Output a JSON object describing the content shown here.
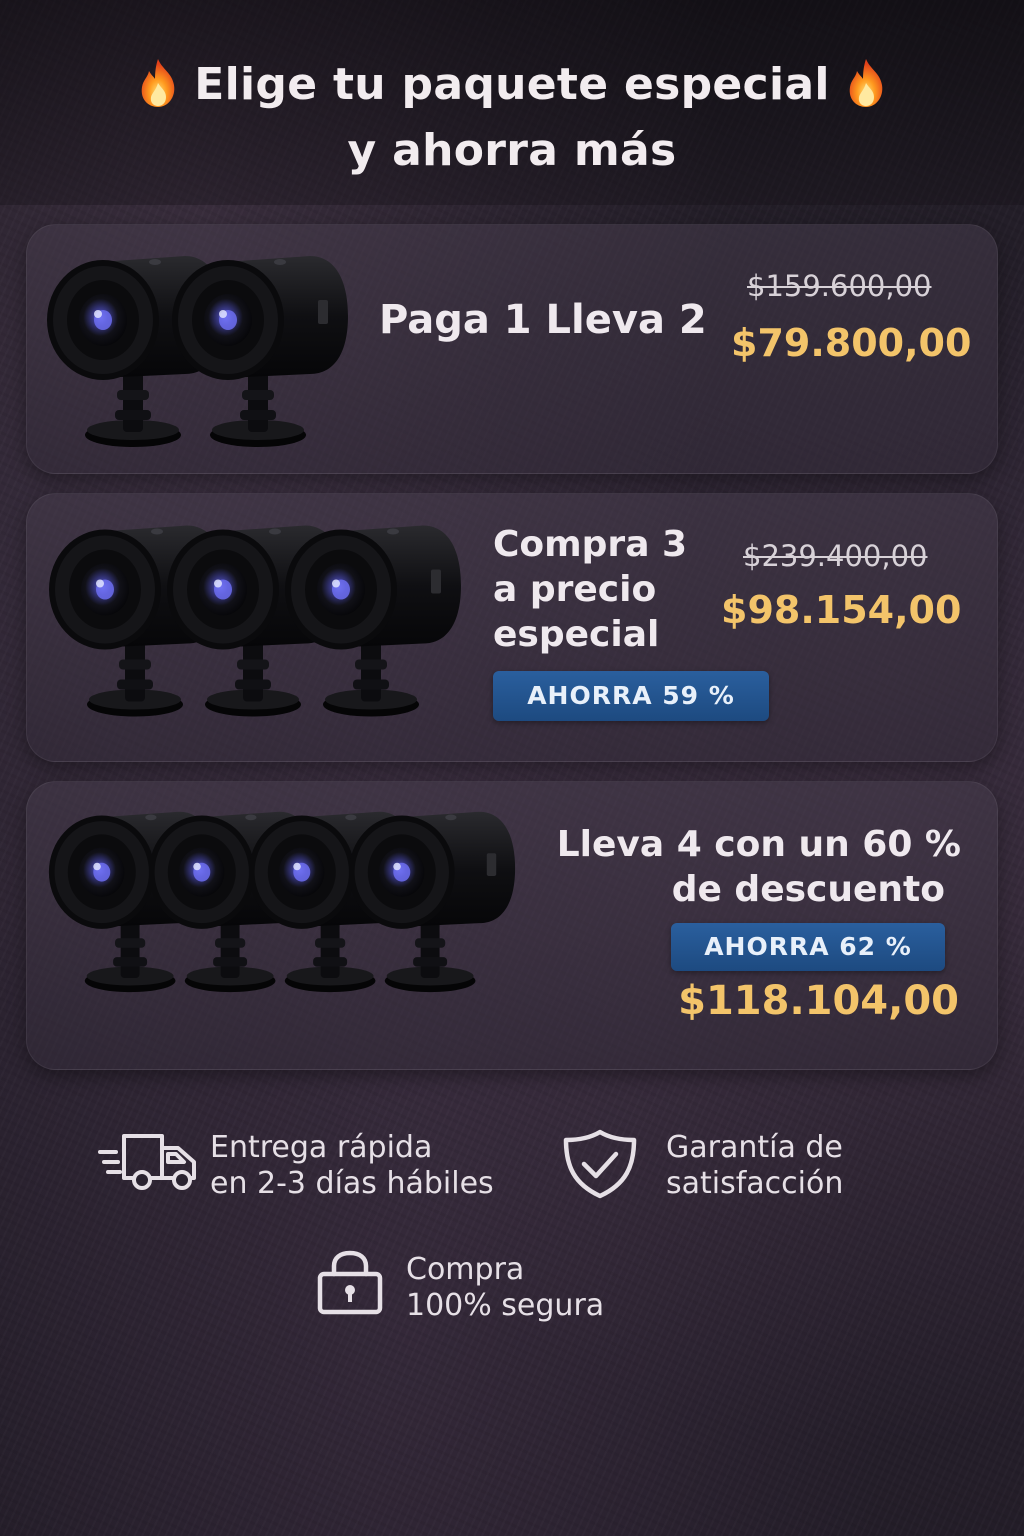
{
  "header": {
    "title_line1": "Elige tu paquete especial",
    "title_line2": "y ahorra más",
    "left_icon": "fire-emoji-icon",
    "right_icon": "fire-emoji-icon"
  },
  "packages": [
    {
      "title": "Paga 1 Lleva 2",
      "old_price": "$159.600,00",
      "price": "$79.800,00",
      "camera_count": 2
    },
    {
      "title_lines": [
        "Compra 3",
        "a precio",
        "especial"
      ],
      "old_price": "$239.400,00",
      "price": "$98.154,00",
      "badge": "AHORRA 59 %",
      "camera_count": 3
    },
    {
      "title_lines": [
        "Lleva 4 con un 60 %",
        "de descuento"
      ],
      "badge": "AHORRA 62 %",
      "price": "$118.104,00",
      "camera_count": 4
    }
  ],
  "features": [
    {
      "icon": "delivery-truck-icon",
      "lines": [
        "Entrega rápida",
        "en 2-3 días hábiles"
      ]
    },
    {
      "icon": "shield-check-icon",
      "lines": [
        "Garantía de",
        "satisfacción"
      ]
    },
    {
      "icon": "padlock-icon",
      "lines": [
        "Compra",
        "100% segura"
      ]
    }
  ],
  "colors": {
    "price": "#f3c46a",
    "badge": "#1f4d85",
    "background": "#2a2330"
  }
}
